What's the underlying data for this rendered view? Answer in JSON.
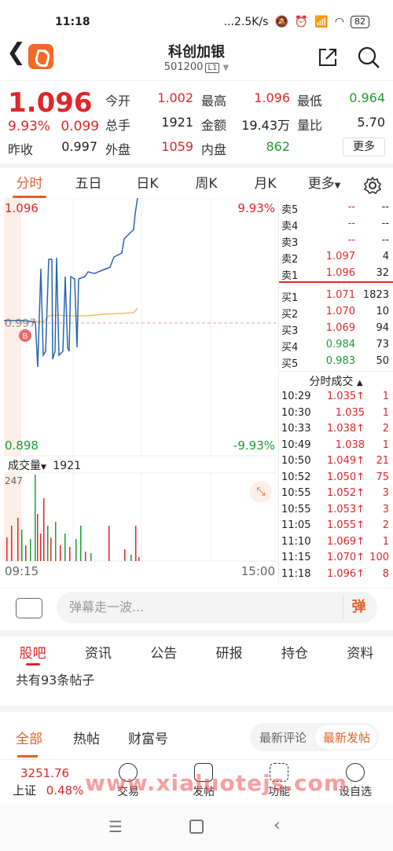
{
  "status_bar": {
    "time": "11:18",
    "network_speed": "...2.5K/s",
    "battery": "82"
  },
  "header": {
    "title": "科创加银",
    "code": "501200",
    "level": "L1"
  },
  "quote": {
    "price": "1.096",
    "change_pct": "9.93%",
    "change_abs": "0.099",
    "fields": [
      {
        "label": "今开",
        "value": "1.002",
        "color": "red"
      },
      {
        "label": "最高",
        "value": "1.096",
        "color": "red"
      },
      {
        "label": "最低",
        "value": "0.964",
        "color": "green"
      },
      {
        "label": "总手",
        "value": "1921",
        "color": "black"
      },
      {
        "label": "金额",
        "value": "19.43万",
        "color": "black"
      },
      {
        "label": "量比",
        "value": "5.70",
        "color": "black"
      },
      {
        "label": "昨收",
        "value": "0.997",
        "color": "black"
      },
      {
        "label": "外盘",
        "value": "1059",
        "color": "red"
      },
      {
        "label": "内盘",
        "value": "862",
        "color": "green"
      }
    ],
    "more_label": "更多"
  },
  "chart_tabs": [
    "分时",
    "五日",
    "日K",
    "周K",
    "月K",
    "更多"
  ],
  "chart": {
    "top_price": "1.096",
    "top_pct": "9.93%",
    "bottom_price": "0.898",
    "bottom_pct": "-9.93%",
    "prev_close_label": "0.997",
    "badge": "B",
    "volume_label": "成交量",
    "volume_value": "1921",
    "volume_max": "247",
    "time_start": "09:15",
    "time_end": "15:00"
  },
  "orderbook": {
    "asks": [
      {
        "label": "卖5",
        "price": "--",
        "vol": "--"
      },
      {
        "label": "卖4",
        "price": "--",
        "vol": "--"
      },
      {
        "label": "卖3",
        "price": "--",
        "vol": "--"
      },
      {
        "label": "卖2",
        "price": "1.097",
        "vol": "4"
      },
      {
        "label": "卖1",
        "price": "1.096",
        "vol": "32"
      }
    ],
    "bids": [
      {
        "label": "买1",
        "price": "1.071",
        "vol": "1823",
        "color": "red"
      },
      {
        "label": "买2",
        "price": "1.070",
        "vol": "10",
        "color": "red"
      },
      {
        "label": "买3",
        "price": "1.069",
        "vol": "94",
        "color": "red"
      },
      {
        "label": "买4",
        "price": "0.984",
        "vol": "73",
        "color": "green"
      },
      {
        "label": "买5",
        "price": "0.983",
        "vol": "50",
        "color": "green"
      }
    ],
    "trades_title": "分时成交",
    "trades": [
      {
        "time": "10:29",
        "price": "1.035↑",
        "vol": "1"
      },
      {
        "time": "10:30",
        "price": "1.035",
        "vol": "1"
      },
      {
        "time": "10:33",
        "price": "1.038↑",
        "vol": "2"
      },
      {
        "time": "10:49",
        "price": "1.038",
        "vol": "1"
      },
      {
        "time": "10:50",
        "price": "1.049↑",
        "vol": "21"
      },
      {
        "time": "10:52",
        "price": "1.050↑",
        "vol": "75"
      },
      {
        "time": "10:55",
        "price": "1.052↑",
        "vol": "3"
      },
      {
        "time": "10:55",
        "price": "1.053↑",
        "vol": "3"
      },
      {
        "time": "11:05",
        "price": "1.055↑",
        "vol": "2"
      },
      {
        "time": "11:10",
        "price": "1.069↑",
        "vol": "1"
      },
      {
        "time": "11:15",
        "price": "1.070↑",
        "vol": "100"
      },
      {
        "time": "11:18",
        "price": "1.096↑",
        "vol": "8"
      }
    ]
  },
  "danmu": {
    "placeholder": "弹幕走一波...",
    "button": "弹"
  },
  "ugc_tabs": [
    "股吧",
    "资讯",
    "公告",
    "研报",
    "持仓",
    "资料"
  ],
  "post_count": "共有93条帖子",
  "feed_tabs": [
    "全部",
    "热帖",
    "财富号"
  ],
  "sort": [
    "最新评论",
    "最新发帖"
  ],
  "bottom_nav": {
    "index_value": "3251.76",
    "index_name": "上证",
    "index_pct": "0.48%",
    "items": [
      "交易",
      "发帖",
      "功能",
      "设自选"
    ]
  },
  "watermark": "www.xialuotejs.com"
}
